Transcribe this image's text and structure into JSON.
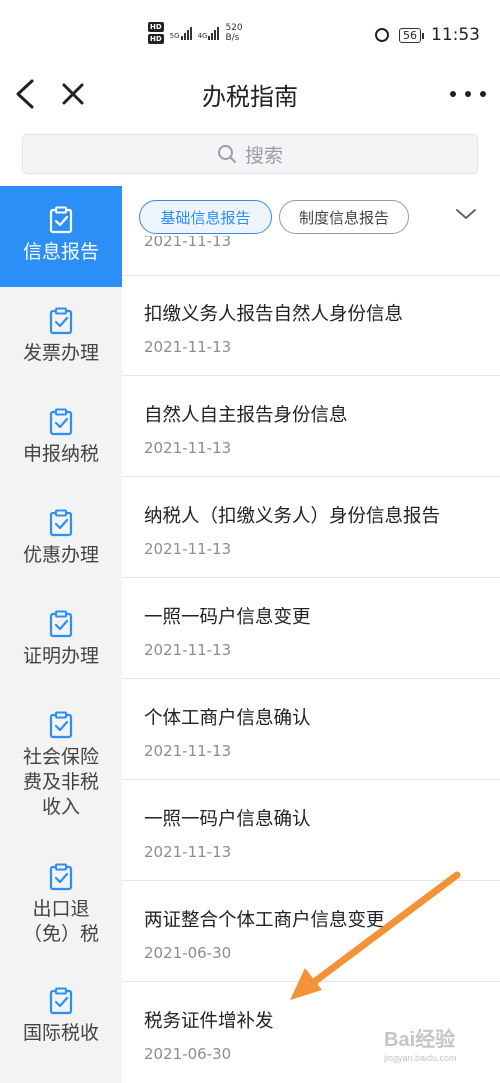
{
  "status_bar": {
    "hd1": "HD",
    "hd2": "HD",
    "net1": "5G",
    "net2": "4G",
    "speed_value": "520",
    "speed_unit": "B/s",
    "battery": "56",
    "time": "11:53"
  },
  "header": {
    "title": "办税指南"
  },
  "search": {
    "placeholder": "搜索"
  },
  "sidebar": {
    "items": [
      {
        "label": "信息报告",
        "active": true
      },
      {
        "label": "发票办理"
      },
      {
        "label": "申报纳税"
      },
      {
        "label": "优惠办理"
      },
      {
        "label": "证明办理"
      },
      {
        "label": "社会保险费及非税收入"
      },
      {
        "label": "出口退（免）税"
      },
      {
        "label": "国际税收"
      }
    ]
  },
  "tabs": {
    "items": [
      {
        "label": "基础信息报告",
        "active": true
      },
      {
        "label": "制度信息报告"
      }
    ]
  },
  "list": {
    "clipped_date": "2021-11-13",
    "items": [
      {
        "title": "扣缴义务人报告自然人身份信息",
        "date": "2021-11-13"
      },
      {
        "title": "自然人自主报告身份信息",
        "date": "2021-11-13"
      },
      {
        "title": "纳税人（扣缴义务人）身份信息报告",
        "date": "2021-11-13"
      },
      {
        "title": "一照一码户信息变更",
        "date": "2021-11-13"
      },
      {
        "title": "个体工商户信息确认",
        "date": "2021-11-13"
      },
      {
        "title": "一照一码户信息确认",
        "date": "2021-11-13"
      },
      {
        "title": "两证整合个体工商户信息变更",
        "date": "2021-06-30"
      },
      {
        "title": "税务证件增补发",
        "date": "2021-06-30"
      }
    ]
  },
  "watermark": {
    "text": "Bai经验",
    "sub": "jingyan.baidu.com"
  },
  "colors": {
    "accent": "#2b8ff7",
    "sidebar_bg": "#f3f3f3",
    "arrow": "#f39237"
  }
}
